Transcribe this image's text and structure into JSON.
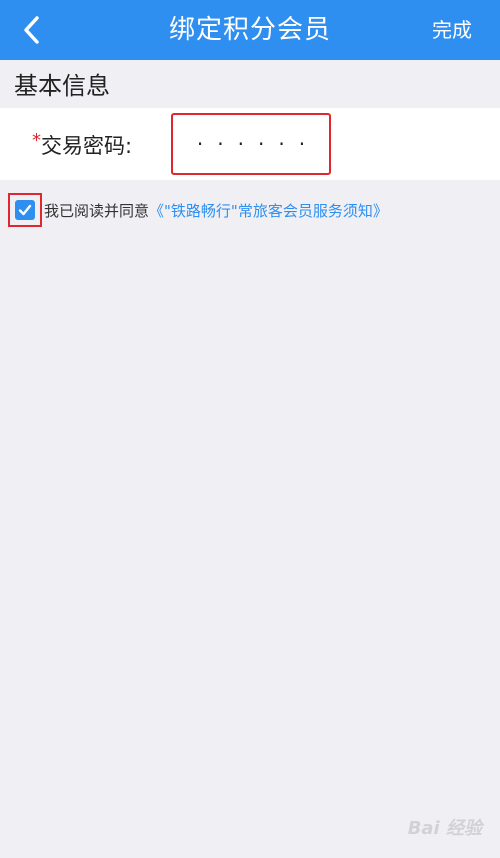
{
  "header": {
    "title": "绑定积分会员",
    "done_label": "完成",
    "background": "#2f8ff0"
  },
  "section": {
    "title": "基本信息"
  },
  "form": {
    "required_mark": "*",
    "password_label": "交易密码:",
    "password_value": "······"
  },
  "agreement": {
    "checked": true,
    "text": "我已阅读并同意",
    "link_text": "《\"铁路畅行\"常旅客会员服务须知》"
  },
  "watermark": "Bai 经验",
  "colors": {
    "accent": "#2f8ff0",
    "highlight": "#e0262e",
    "background": "#efeff4"
  }
}
